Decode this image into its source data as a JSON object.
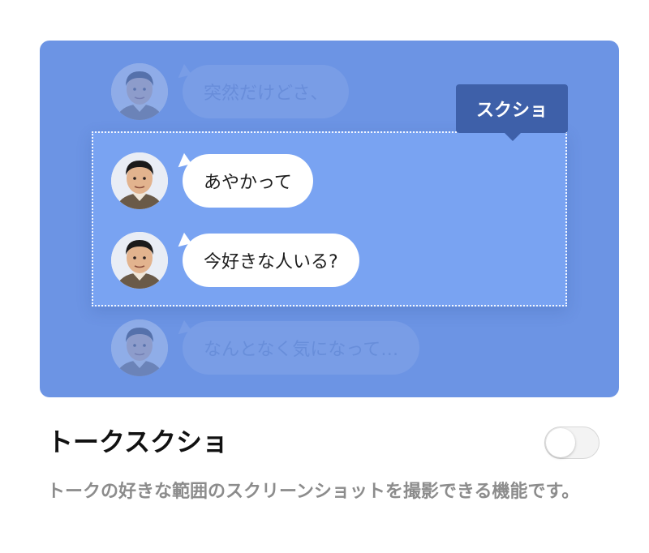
{
  "preview": {
    "messages_above": [
      {
        "text": "突然だけどさ、"
      }
    ],
    "selected_messages": [
      {
        "text": "あやかって"
      },
      {
        "text": "今好きな人いる?"
      }
    ],
    "messages_below": [
      {
        "text": "なんとなく気になって…"
      }
    ],
    "selection_tag": "スクショ",
    "colors": {
      "background": "#6c94e4",
      "selection": "#79a3f2",
      "tag": "#3e60a9"
    }
  },
  "feature": {
    "title": "トークスクショ",
    "description": "トークの好きな範囲のスクリーンショットを撮影できる機能です。",
    "toggle_on": false
  }
}
